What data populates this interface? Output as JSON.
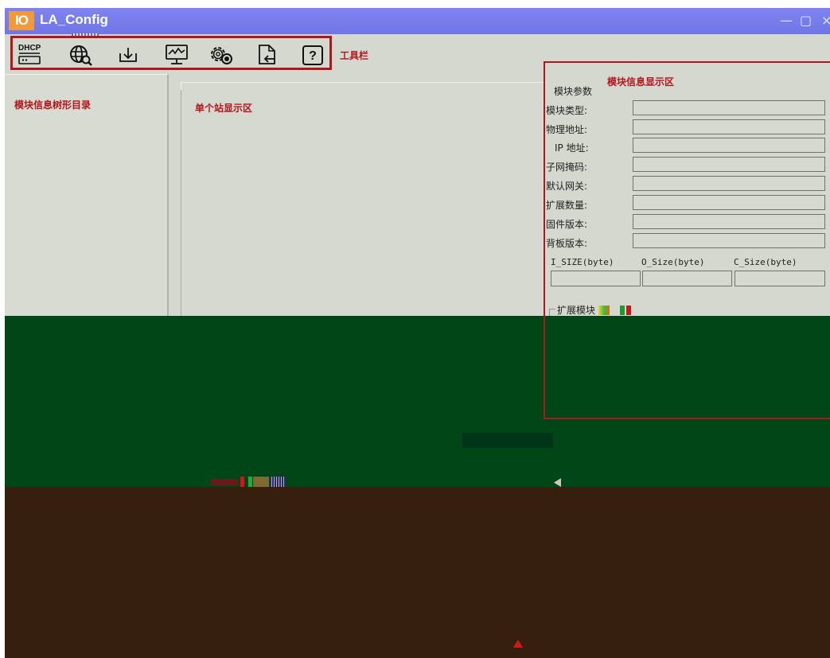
{
  "window": {
    "logo_text": "IO",
    "title": "LA_Config",
    "controls": {
      "minimize": "—",
      "maximize": "▢",
      "close": "×"
    }
  },
  "toolbar": {
    "label": "工具栏",
    "buttons": [
      {
        "name": "dhcp-button",
        "text": "DHCP",
        "icon": "dhcp-icon"
      },
      {
        "name": "network-scan-button",
        "icon": "globe-search-icon"
      },
      {
        "name": "download-button",
        "icon": "download-icon"
      },
      {
        "name": "monitor-button",
        "icon": "monitor-chart-icon"
      },
      {
        "name": "settings-button",
        "icon": "gear-icon"
      },
      {
        "name": "import-button",
        "icon": "file-import-icon"
      },
      {
        "name": "help-button",
        "text": "?",
        "icon": "help-icon"
      }
    ]
  },
  "tree_panel": {
    "label": "模块信息树形目录"
  },
  "single_station_panel": {
    "label": "单个站显示区"
  },
  "module_info": {
    "area_label": "模块信息显示区",
    "group_title": "模块参数",
    "fields": [
      {
        "label": "模块类型:",
        "value": ""
      },
      {
        "label": "物理地址:",
        "value": ""
      },
      {
        "label": "IP 地址:",
        "value": ""
      },
      {
        "label": "子网掩码:",
        "value": ""
      },
      {
        "label": "默认网关:",
        "value": ""
      },
      {
        "label": "扩展数量:",
        "value": ""
      },
      {
        "label": "固件版本:",
        "value": ""
      },
      {
        "label": "背板版本:",
        "value": ""
      }
    ],
    "sizes": {
      "i_size_label": "I_SIZE(byte)",
      "o_size_label": "O_Size(byte)",
      "c_size_label": "C_Size(byte)",
      "i_size_value": "",
      "o_size_value": "",
      "c_size_value": ""
    },
    "extension_group_label": "扩展模块"
  },
  "colors": {
    "titlebar": "#7176e6",
    "annotation_red": "#b4151c",
    "window_bg": "#d4d8cf",
    "overlay_green": "#004617",
    "overlay_brown": "#361f0d"
  }
}
